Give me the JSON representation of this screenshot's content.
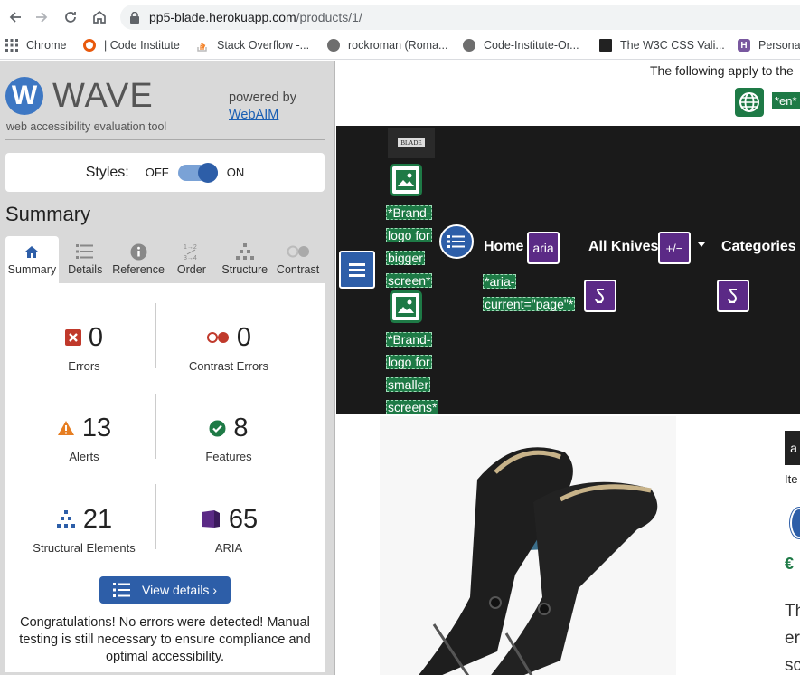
{
  "browser": {
    "url_host": "pp5-blade.herokuapp.com",
    "url_path": "/products/1/",
    "bookmarks": [
      {
        "label": "Chrome",
        "icon": "grid-icon",
        "color": "#5f6368"
      },
      {
        "label": "| Code Institute",
        "icon": "code-institute-icon",
        "color": "#e8590c"
      },
      {
        "label": "Stack Overflow -...",
        "icon": "stackoverflow-icon",
        "color": "#f48024"
      },
      {
        "label": "rockroman (Roma...",
        "icon": "github-icon",
        "color": "#6e6e6e"
      },
      {
        "label": "Code-Institute-Or...",
        "icon": "github-icon",
        "color": "#6e6e6e"
      },
      {
        "label": "The W3C CSS Vali...",
        "icon": "w3c-icon",
        "color": "#222222"
      },
      {
        "label": "Persona",
        "icon": "heroku-icon",
        "color": "#79589f"
      }
    ]
  },
  "wave": {
    "logo_letter": "W",
    "wordmark": "WAVE",
    "tagline": "web accessibility evaluation tool",
    "powered_by": "powered by",
    "webaim": "WebAIM",
    "styles_label": "Styles:",
    "off": "OFF",
    "on": "ON",
    "summary_heading": "Summary",
    "tabs": [
      "Summary",
      "Details",
      "Reference",
      "Order",
      "Structure",
      "Contrast"
    ],
    "stats": {
      "errors": {
        "value": "0",
        "label": "Errors"
      },
      "contrast": {
        "value": "0",
        "label": "Contrast Errors"
      },
      "alerts": {
        "value": "13",
        "label": "Alerts"
      },
      "features": {
        "value": "8",
        "label": "Features"
      },
      "structural": {
        "value": "21",
        "label": "Structural Elements"
      },
      "aria": {
        "value": "65",
        "label": "ARIA"
      }
    },
    "view_details": "View details ›",
    "congrats": "Congratulations! No errors were detected! Manual testing is still necessary to ensure compliance and optimal accessibility."
  },
  "page": {
    "apply_text": "The following apply to the",
    "lang_tag": "*en*",
    "brand_small_text": "BLADE",
    "brand_big": [
      "*Brand-",
      "logo for",
      "bigger",
      "screen*"
    ],
    "brand_small": [
      "*Brand-",
      "logo for",
      "smaller",
      "screens*"
    ],
    "nav": {
      "home": "Home",
      "aria_label": "aria",
      "all_knives": "All Knives",
      "plus_minus": "+/−",
      "categories": "Categories",
      "aria_current": [
        "*aria-",
        "current=\"page\"*"
      ]
    },
    "side_labels": {
      "item": "Ite",
      "euro": "€",
      "text_1": "Th",
      "text_2": "er",
      "text_3": "sc",
      "dark_tab": "a"
    }
  },
  "colors": {
    "wave_blue": "#2d5ea8",
    "wave_green": "#1e7a46",
    "aria_purple": "#5b2a86",
    "error_red": "#c0392b",
    "alert_orange": "#e67e22"
  }
}
